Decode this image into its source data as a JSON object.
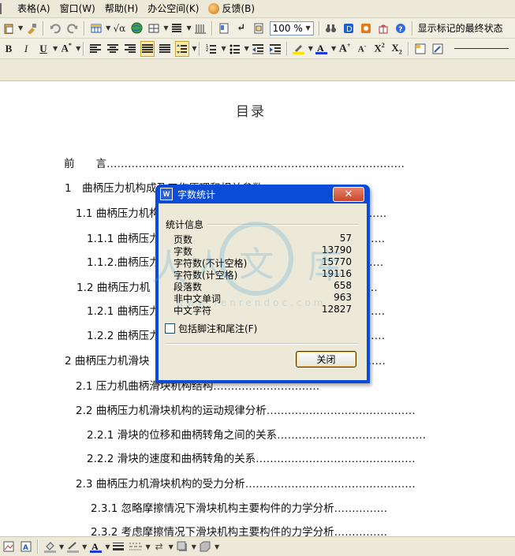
{
  "menubar": {
    "items": [
      "表格(A)",
      "窗口(W)",
      "帮助(H)",
      "办公空间(K)"
    ],
    "feedback": "反馈(B)"
  },
  "toolbar": {
    "zoom": "100 %",
    "show_markup": "显示标记的最终状态",
    "font_buttons": {
      "bold": "B",
      "italic": "I",
      "underline": "U"
    }
  },
  "document": {
    "title": "目录",
    "toc": [
      {
        "text": "前　　言",
        "dots": "…………………………………………………………………………"
      },
      {
        "text": "1　曲柄压力机构成及工作原理和相关参数",
        "dots": ""
      },
      {
        "text": "1.1 曲柄压力机构",
        "dots": "……………"
      },
      {
        "text": "1.1.1 曲柄压力",
        "dots": "……………"
      },
      {
        "text": "1.1.2.曲柄压力",
        "dots": "……………"
      },
      {
        "text": "1.2  曲柄压力机",
        "dots": "……………"
      },
      {
        "text": "1.2.1 曲柄压力",
        "dots": "……………"
      },
      {
        "text": "1.2.2 曲柄压力",
        "dots": "……………"
      },
      {
        "text": "2  曲柄压力机滑块",
        "dots": "……………"
      },
      {
        "text": "2.1 压力机曲柄滑块机构结构",
        "dots": "…………………………"
      },
      {
        "text": "2.2 曲柄压力机滑块机构的运动规律分析",
        "dots": "……………………………………"
      },
      {
        "text": "2.2.1 滑块的位移和曲柄转角之间的关系",
        "dots": "……………………………………"
      },
      {
        "text": "2.2.2 滑块的速度和曲柄转角的关系",
        "dots": "………………………………………"
      },
      {
        "text": "2.3 曲柄压力机滑块机构的受力分析",
        "dots": "…………………………………………"
      },
      {
        "text": "2.3.1 忽略摩擦情况下滑块机构主要构件的力学分析",
        "dots": "……………"
      },
      {
        "text": "2.3.2 考虑摩擦情况下滑块机构主要构件的力学分析",
        "dots": "……………"
      }
    ]
  },
  "dialog": {
    "title": "字数统计",
    "close_x": "✕",
    "group_title": "统计信息",
    "stats": [
      {
        "label": "页数",
        "value": "57"
      },
      {
        "label": "字数",
        "value": "13790"
      },
      {
        "label": "字符数(不计空格)",
        "value": "15770"
      },
      {
        "label": "字符数(计空格)",
        "value": "19116"
      },
      {
        "label": "段落数",
        "value": "658"
      },
      {
        "label": "非中文单词",
        "value": "963"
      },
      {
        "label": "中文字符",
        "value": "12827"
      }
    ],
    "checkbox_label": "包括脚注和尾注(F)",
    "checkbox_checked": false,
    "close_button": "关闭"
  },
  "watermark": {
    "text": "人人文库",
    "url": "www.renrendoc.com"
  }
}
